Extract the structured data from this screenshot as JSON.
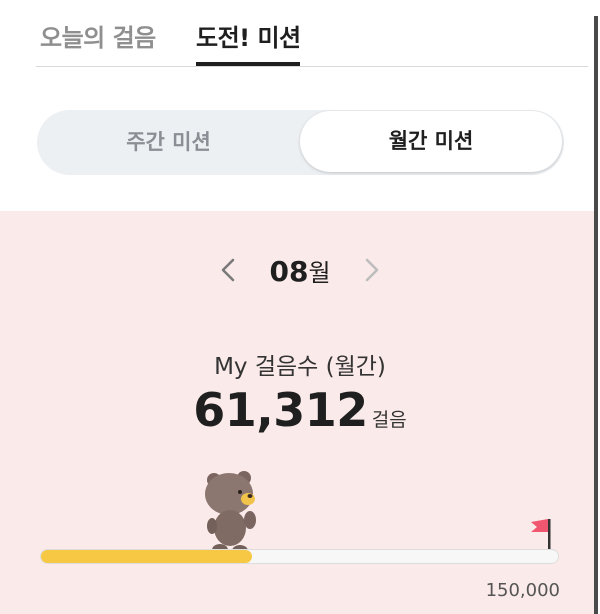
{
  "tabs": [
    {
      "label": "오늘의 걸음",
      "active": false
    },
    {
      "label": "도전! 미션",
      "active": true
    }
  ],
  "segment": {
    "weekly_label": "주간 미션",
    "monthly_label": "월간 미션",
    "selected": "monthly"
  },
  "month": {
    "number": "08",
    "unit": "월"
  },
  "steps": {
    "caption": "My 걸음수 (월간)",
    "value": "61,312",
    "unit": "걸음"
  },
  "progress": {
    "current": 61312,
    "goal": 150000,
    "goal_label": "150,000",
    "fraction": 0.4087
  },
  "icons": {
    "prev": "chevron-left-icon",
    "next": "chevron-right-icon",
    "character": "bear-character",
    "goal": "flag-icon"
  },
  "colors": {
    "panel_bg": "#fbeaea",
    "progress_fill": "#f7c843",
    "flag": "#f0566f",
    "segment_bg": "#edf0f3"
  }
}
